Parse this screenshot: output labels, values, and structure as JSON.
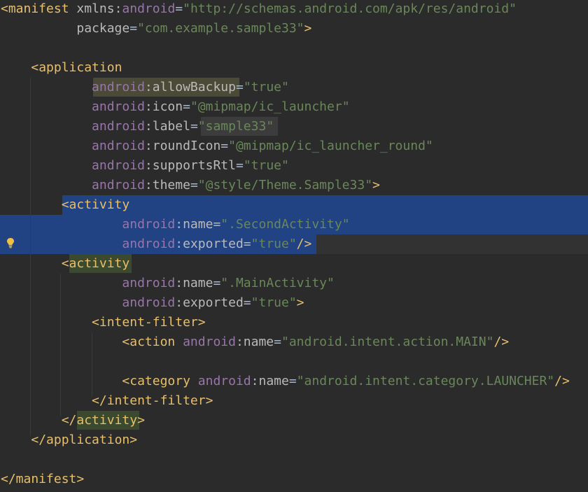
{
  "editor": {
    "file_type": "AndroidManifest.xml",
    "colors": {
      "background": "#2b2b2b",
      "tag": "#e8bf6a",
      "attribute": "#bababa",
      "namespace": "#9876aa",
      "value": "#6a8759",
      "selection": "#214283"
    },
    "lines": [
      {
        "tokens": [
          {
            "t": "tag",
            "v": "<manifest"
          },
          {
            "t": "punct",
            "v": " "
          },
          {
            "t": "attr",
            "v": "xmlns"
          },
          {
            "t": "punct",
            "v": ":"
          },
          {
            "t": "ns",
            "v": "android"
          },
          {
            "t": "punct",
            "v": "="
          },
          {
            "t": "val",
            "v": "\"http://schemas.android.com/apk/res/android\""
          }
        ]
      },
      {
        "tokens": [
          {
            "t": "punct",
            "v": "          "
          },
          {
            "t": "attr",
            "v": "package"
          },
          {
            "t": "punct",
            "v": "="
          },
          {
            "t": "val",
            "v": "\"com.example.sample33\""
          },
          {
            "t": "tag",
            "v": ">"
          }
        ]
      },
      {
        "tokens": []
      },
      {
        "tokens": [
          {
            "t": "punct",
            "v": "    "
          },
          {
            "t": "tag",
            "v": "<application"
          }
        ]
      },
      {
        "tokens": [
          {
            "t": "punct",
            "v": "            "
          },
          {
            "t": "ns",
            "v": "android"
          },
          {
            "t": "punct",
            "v": ":"
          },
          {
            "t": "attr",
            "v": "allowBackup"
          },
          {
            "t": "punct",
            "v": "="
          },
          {
            "t": "val",
            "v": "\"true\""
          }
        ]
      },
      {
        "tokens": [
          {
            "t": "punct",
            "v": "            "
          },
          {
            "t": "ns",
            "v": "android"
          },
          {
            "t": "punct",
            "v": ":"
          },
          {
            "t": "attr",
            "v": "icon"
          },
          {
            "t": "punct",
            "v": "="
          },
          {
            "t": "val",
            "v": "\"@mipmap/ic_launcher\""
          }
        ]
      },
      {
        "tokens": [
          {
            "t": "punct",
            "v": "            "
          },
          {
            "t": "ns",
            "v": "android"
          },
          {
            "t": "punct",
            "v": ":"
          },
          {
            "t": "attr",
            "v": "label"
          },
          {
            "t": "punct",
            "v": "="
          },
          {
            "t": "val",
            "v": "\"sample33\""
          }
        ]
      },
      {
        "tokens": [
          {
            "t": "punct",
            "v": "            "
          },
          {
            "t": "ns",
            "v": "android"
          },
          {
            "t": "punct",
            "v": ":"
          },
          {
            "t": "attr",
            "v": "roundIcon"
          },
          {
            "t": "punct",
            "v": "="
          },
          {
            "t": "val",
            "v": "\"@mipmap/ic_launcher_round\""
          }
        ]
      },
      {
        "tokens": [
          {
            "t": "punct",
            "v": "            "
          },
          {
            "t": "ns",
            "v": "android"
          },
          {
            "t": "punct",
            "v": ":"
          },
          {
            "t": "attr",
            "v": "supportsRtl"
          },
          {
            "t": "punct",
            "v": "="
          },
          {
            "t": "val",
            "v": "\"true\""
          }
        ]
      },
      {
        "tokens": [
          {
            "t": "punct",
            "v": "            "
          },
          {
            "t": "ns",
            "v": "android"
          },
          {
            "t": "punct",
            "v": ":"
          },
          {
            "t": "attr",
            "v": "theme"
          },
          {
            "t": "punct",
            "v": "="
          },
          {
            "t": "val",
            "v": "\"@style/Theme.Sample33\""
          },
          {
            "t": "tag",
            "v": ">"
          }
        ]
      },
      {
        "tokens": [
          {
            "t": "punct",
            "v": "        "
          },
          {
            "t": "tag",
            "v": "<activity"
          }
        ]
      },
      {
        "tokens": [
          {
            "t": "punct",
            "v": "                "
          },
          {
            "t": "ns",
            "v": "android"
          },
          {
            "t": "punct",
            "v": ":"
          },
          {
            "t": "attr",
            "v": "name"
          },
          {
            "t": "punct",
            "v": "="
          },
          {
            "t": "val",
            "v": "\".SecondActivity\""
          }
        ]
      },
      {
        "tokens": [
          {
            "t": "punct",
            "v": "                "
          },
          {
            "t": "ns",
            "v": "android"
          },
          {
            "t": "punct",
            "v": ":"
          },
          {
            "t": "attr",
            "v": "exported"
          },
          {
            "t": "punct",
            "v": "="
          },
          {
            "t": "val",
            "v": "\"true\""
          },
          {
            "t": "tag",
            "v": "/>"
          }
        ]
      },
      {
        "tokens": [
          {
            "t": "punct",
            "v": "        "
          },
          {
            "t": "tag",
            "v": "<activity"
          }
        ]
      },
      {
        "tokens": [
          {
            "t": "punct",
            "v": "                "
          },
          {
            "t": "ns",
            "v": "android"
          },
          {
            "t": "punct",
            "v": ":"
          },
          {
            "t": "attr",
            "v": "name"
          },
          {
            "t": "punct",
            "v": "="
          },
          {
            "t": "val",
            "v": "\".MainActivity\""
          }
        ]
      },
      {
        "tokens": [
          {
            "t": "punct",
            "v": "                "
          },
          {
            "t": "ns",
            "v": "android"
          },
          {
            "t": "punct",
            "v": ":"
          },
          {
            "t": "attr",
            "v": "exported"
          },
          {
            "t": "punct",
            "v": "="
          },
          {
            "t": "val",
            "v": "\"true\""
          },
          {
            "t": "tag",
            "v": ">"
          }
        ]
      },
      {
        "tokens": [
          {
            "t": "punct",
            "v": "            "
          },
          {
            "t": "tag",
            "v": "<intent-filter>"
          }
        ]
      },
      {
        "tokens": [
          {
            "t": "punct",
            "v": "                "
          },
          {
            "t": "tag",
            "v": "<action"
          },
          {
            "t": "punct",
            "v": " "
          },
          {
            "t": "ns",
            "v": "android"
          },
          {
            "t": "punct",
            "v": ":"
          },
          {
            "t": "attr",
            "v": "name"
          },
          {
            "t": "punct",
            "v": "="
          },
          {
            "t": "val",
            "v": "\"android.intent.action.MAIN\""
          },
          {
            "t": "tag",
            "v": "/>"
          }
        ]
      },
      {
        "tokens": []
      },
      {
        "tokens": [
          {
            "t": "punct",
            "v": "                "
          },
          {
            "t": "tag",
            "v": "<category"
          },
          {
            "t": "punct",
            "v": " "
          },
          {
            "t": "ns",
            "v": "android"
          },
          {
            "t": "punct",
            "v": ":"
          },
          {
            "t": "attr",
            "v": "name"
          },
          {
            "t": "punct",
            "v": "="
          },
          {
            "t": "val",
            "v": "\"android.intent.category.LAUNCHER\""
          },
          {
            "t": "tag",
            "v": "/>"
          }
        ]
      },
      {
        "tokens": [
          {
            "t": "punct",
            "v": "            "
          },
          {
            "t": "tag",
            "v": "</intent-filter>"
          }
        ]
      },
      {
        "tokens": [
          {
            "t": "punct",
            "v": "        "
          },
          {
            "t": "tag",
            "v": "</activity>"
          }
        ]
      },
      {
        "tokens": [
          {
            "t": "punct",
            "v": "    "
          },
          {
            "t": "tag",
            "v": "</application>"
          }
        ]
      },
      {
        "tokens": []
      },
      {
        "tokens": [
          {
            "t": "tag",
            "v": "</manifest>"
          }
        ]
      }
    ],
    "gutter": {
      "intention_icon": "lightbulb-icon",
      "intention_line": 13
    }
  }
}
